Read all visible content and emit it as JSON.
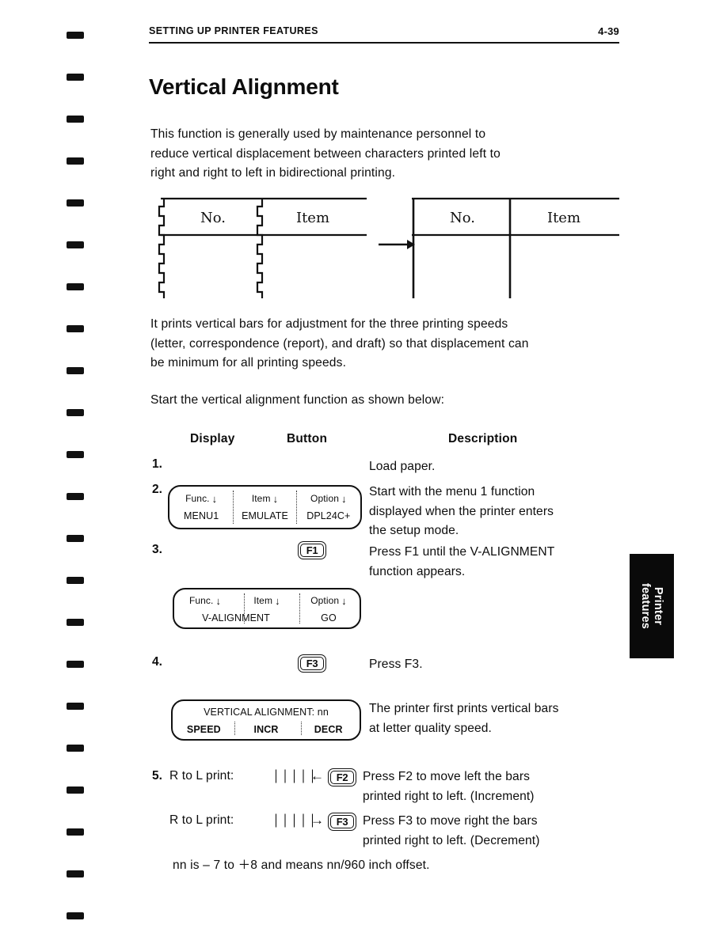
{
  "header": {
    "title": "SETTING UP PRINTER FEATURES",
    "folio": "4-39"
  },
  "page_title": "Vertical Alignment",
  "paragraphs": {
    "intro": "This function is generally used by maintenance personnel to\nreduce vertical displacement between characters printed left to\nright and right to left in bidirectional printing.",
    "bars": "It prints vertical bars for adjustment for the three printing speeds\n(letter, correspondence (report), and draft) so that displacement can\nbe minimum for all printing speeds.",
    "start": "Start the vertical alignment function as shown below:",
    "nn_note": "nn is – 7 to ＋8 and means nn/960 inch offset."
  },
  "figure": {
    "left_table": {
      "caption": "misaligned-table",
      "columns": [
        "No.",
        "Item"
      ]
    },
    "arrow": "right-arrow",
    "right_table": {
      "caption": "aligned-table",
      "columns": [
        "No.",
        "Item"
      ]
    }
  },
  "procedure": {
    "columns": {
      "display": "Display",
      "button": "Button",
      "description": "Description"
    },
    "steps": [
      {
        "number": "1.",
        "description": "Load paper."
      },
      {
        "number": "2.",
        "description": "Start with the menu 1 function\ndisplayed when the printer enters\nthe setup mode.",
        "lcd": {
          "labels": [
            "Func.",
            "Item",
            "Option"
          ],
          "values": [
            "MENU1",
            "EMULATE",
            "DPL24C+"
          ],
          "arrow_glyph": "↓"
        }
      },
      {
        "number": "3.",
        "button": "F1",
        "description": "Press F1 until the V-ALIGNMENT\nfunction appears.",
        "lcd": {
          "labels": [
            "Func.",
            "Item",
            "Option"
          ],
          "values": [
            "V-ALIGNMENT",
            "",
            "GO"
          ],
          "arrow_glyph": "↓"
        }
      },
      {
        "number": "4.",
        "button": "F3",
        "description": "Press F3.",
        "lcd2": {
          "title": "VERTICAL ALIGNMENT: nn",
          "values": [
            "SPEED",
            "INCR",
            "DECR"
          ]
        },
        "description2": "The printer first prints vertical bars\nat letter quality speed."
      },
      {
        "number": "5.",
        "lines": [
          {
            "label": "R to L print:",
            "bars": "│││││",
            "arrow": "←",
            "button": "F2",
            "description": "Press F2 to move left the bars\nprinted right to left. (Increment)"
          },
          {
            "label": "R to L print:",
            "bars": "│││││",
            "arrow": "→",
            "button": "F3",
            "description": "Press F3 to move right the bars\nprinted right to left. (Decrement)"
          }
        ]
      }
    ]
  },
  "thumb_tab": {
    "label": "Printer\nfeatures",
    "color": "#0a0a0a"
  },
  "binding_marks": {
    "count": 22,
    "color": "#111111"
  }
}
